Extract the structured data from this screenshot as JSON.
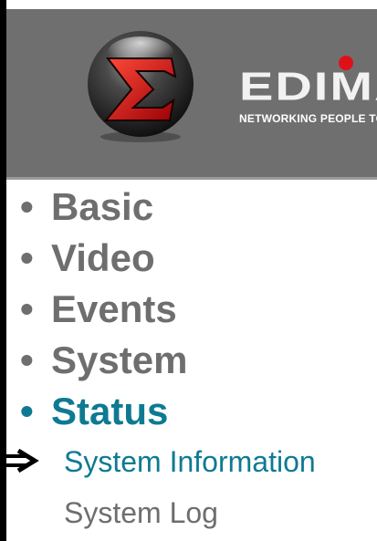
{
  "header": {
    "logo_icon": "sigma-orb-logo",
    "brand_name": "EDIMAX",
    "brand_tagline": "NETWORKING PEOPLE TOGETHER",
    "brand_color": "#6f6f6f"
  },
  "menu": {
    "bullet": "•",
    "items": [
      {
        "label": "Basic",
        "active": false
      },
      {
        "label": "Video",
        "active": false
      },
      {
        "label": "Events",
        "active": false
      },
      {
        "label": "System",
        "active": false
      },
      {
        "label": "Status",
        "active": true
      }
    ],
    "submenu": [
      {
        "label": "System Information",
        "active": true
      },
      {
        "label": "System Log",
        "active": false
      }
    ],
    "active_color": "#0e7a92",
    "inactive_color": "#6e6e6e"
  },
  "pointer": {
    "icon": "arrow-right-icon",
    "target": "System Information"
  }
}
